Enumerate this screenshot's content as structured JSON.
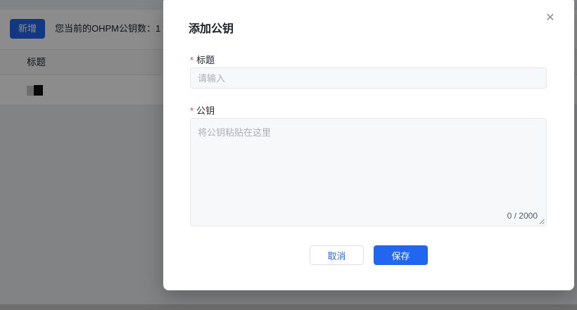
{
  "page": {
    "toolbar": {
      "add_button": "新增",
      "key_count_text": "您当前的OHPM公钥数：1"
    },
    "table": {
      "header": "标题"
    }
  },
  "modal": {
    "title": "添加公钥",
    "close_icon": "✕",
    "title_field": {
      "required_mark": "*",
      "label": "标题",
      "placeholder": "请输入",
      "value": ""
    },
    "key_field": {
      "required_mark": "*",
      "label": "公钥",
      "placeholder": "将公钥粘贴在这里",
      "value": "",
      "counter": "0 / 2000"
    },
    "footer": {
      "cancel_label": "取消",
      "save_label": "保存"
    }
  },
  "colors": {
    "accent_blue": "#2166ee",
    "required_mark_red": "#f53f3f",
    "overlay": "rgba(0,0,0,0.45)"
  }
}
